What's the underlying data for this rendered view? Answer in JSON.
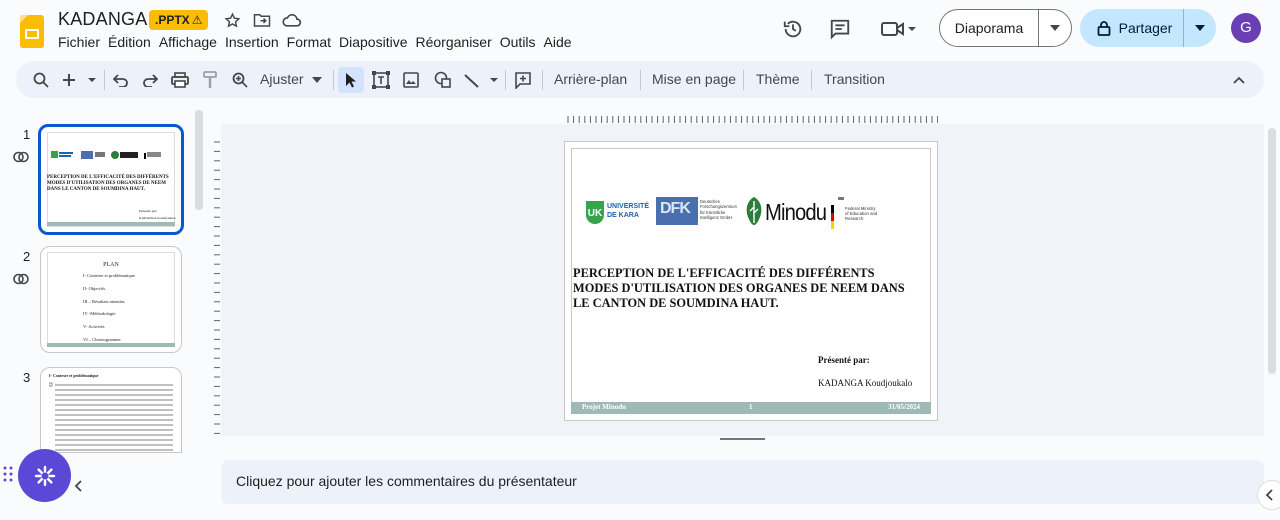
{
  "header": {
    "doc_title": "KADANGA",
    "format_badge": ".PPTX",
    "badge_warning": "⚠",
    "menu": [
      "Fichier",
      "Édition",
      "Affichage",
      "Insertion",
      "Format",
      "Diapositive",
      "Réorganiser",
      "Outils",
      "Aide"
    ],
    "slideshow_label": "Diaporama",
    "share_label": "Partager",
    "avatar_initial": "G"
  },
  "toolbar": {
    "zoom_label": "Ajuster",
    "background_label": "Arrière-plan",
    "layout_label": "Mise en page",
    "theme_label": "Thème",
    "transition_label": "Transition"
  },
  "filmstrip": {
    "slides": [
      {
        "number": "1",
        "title": "PERCEPTION DE L'EFFICACITÉ DES DIFFÉRENTS MODES D'UTILISATION DES ORGANES DE NEEM DANS LE CANTON DE SOUMDINA HAUT.",
        "presented": "Présenté par:",
        "presenter": "KADANGA Koudjoukalo"
      },
      {
        "number": "2",
        "heading": "PLAN",
        "items": [
          "I- Contexte et problématique",
          "II- Objectifs",
          "III – Résultats attendus",
          "IV -Méthodologie",
          "V- Activités",
          "VI – Chronogramme."
        ]
      },
      {
        "number": "3",
        "heading": "I- Contexte et problématique"
      }
    ]
  },
  "slide": {
    "logos": {
      "univ_mark": "UK",
      "univ_line1": "UNIVERSITÉ",
      "univ_line2": "DE KARA",
      "dfk_mark": "DFK",
      "dfk_text": "Deutsches Forschungszentrum für Künstliche Intelligenz GmbH",
      "minodu": "Minodu",
      "bmbf_text": "Federal Ministry of Education and Research"
    },
    "title": "PERCEPTION DE L'EFFICACITÉ DES DIFFÉRENTS MODES D'UTILISATION DES ORGANES DE NEEM DANS LE CANTON DE SOUMDINA HAUT.",
    "presented_label": "Présenté par:",
    "presenter_name": "KADANGA Koudjoukalo",
    "footer": {
      "project": "Projet Minodu",
      "page": "1",
      "date": "31/05/2024"
    }
  },
  "notes": {
    "placeholder": "Cliquez pour ajouter les commentaires du présentateur"
  },
  "colors": {
    "accent_blue": "#0b57d0",
    "share_bg": "#c2e7ff",
    "slide_footer": "#9fbab5",
    "badge_yellow": "#fbbc04",
    "avatar_purple": "#6a3fb4"
  }
}
